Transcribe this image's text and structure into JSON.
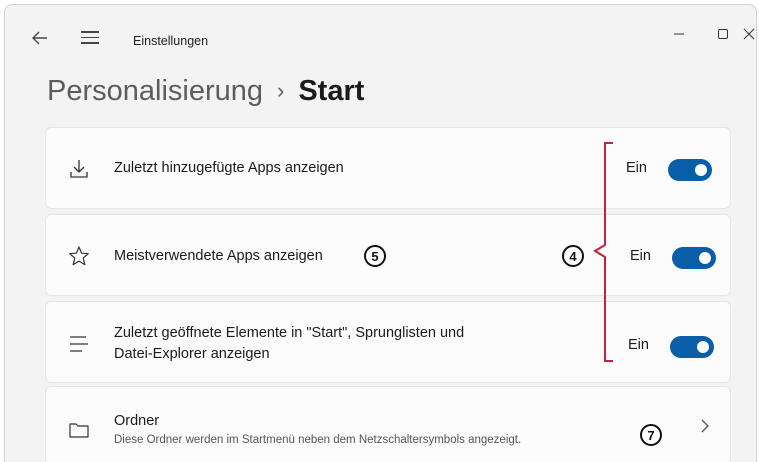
{
  "window": {
    "title": "Einstellungen",
    "back_icon": "arrow-left-icon",
    "menu_icon": "hamburger-icon",
    "controls": [
      "minimize-icon",
      "maximize-icon",
      "close-icon"
    ]
  },
  "breadcrumb": {
    "parent": "Personalisierung",
    "separator": "›",
    "current": "Start"
  },
  "settings": [
    {
      "icon": "download-icon",
      "label": "Zuletzt hinzugefügte Apps anzeigen",
      "state_text": "Ein",
      "on": true
    },
    {
      "icon": "star-icon",
      "label": "Meistverwendete Apps anzeigen",
      "state_text": "Ein",
      "on": true
    },
    {
      "icon": "lines-icon",
      "label_line1": "Zuletzt geöffnete Elemente in \"Start\", Sprunglisten und",
      "label_line2": "Datei-Explorer anzeigen",
      "state_text": "Ein",
      "on": true
    },
    {
      "icon": "folder-icon",
      "label": "Ordner",
      "description": "Diese Ordner werden im Startmenü neben dem Netzschaltersymbols angezeigt."
    }
  ],
  "annotations": {
    "badge_5": "5",
    "badge_4": "4",
    "badge_7": "7",
    "bracket_color": "#c0233a"
  },
  "colors": {
    "accent": "#0a5ea8",
    "background": "#f3f3f3",
    "card": "#fbfbfb"
  }
}
